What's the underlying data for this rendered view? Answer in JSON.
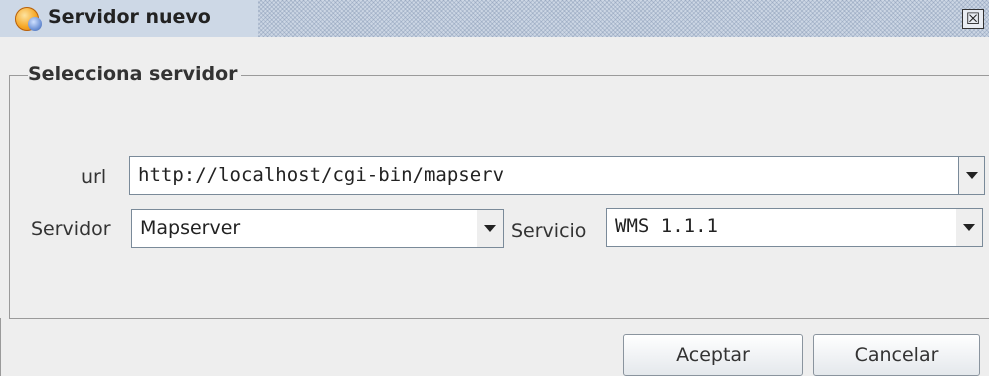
{
  "window": {
    "title": "Servidor nuevo",
    "close_glyph": "☒",
    "icon": "gvsig-globe-icon"
  },
  "group": {
    "title": "Selecciona servidor"
  },
  "url": {
    "label": "url",
    "value": "http://localhost/cgi-bin/mapserv"
  },
  "servidor": {
    "label": "Servidor",
    "value": "Mapserver"
  },
  "servicio": {
    "label": "Servicio",
    "value": "WMS 1.1.1"
  },
  "buttons": {
    "accept": "Aceptar",
    "cancel": "Cancelar"
  },
  "colors": {
    "title_bar": "#ccd6e4",
    "panel": "#eeeeee",
    "border": "#9a9a9a"
  }
}
